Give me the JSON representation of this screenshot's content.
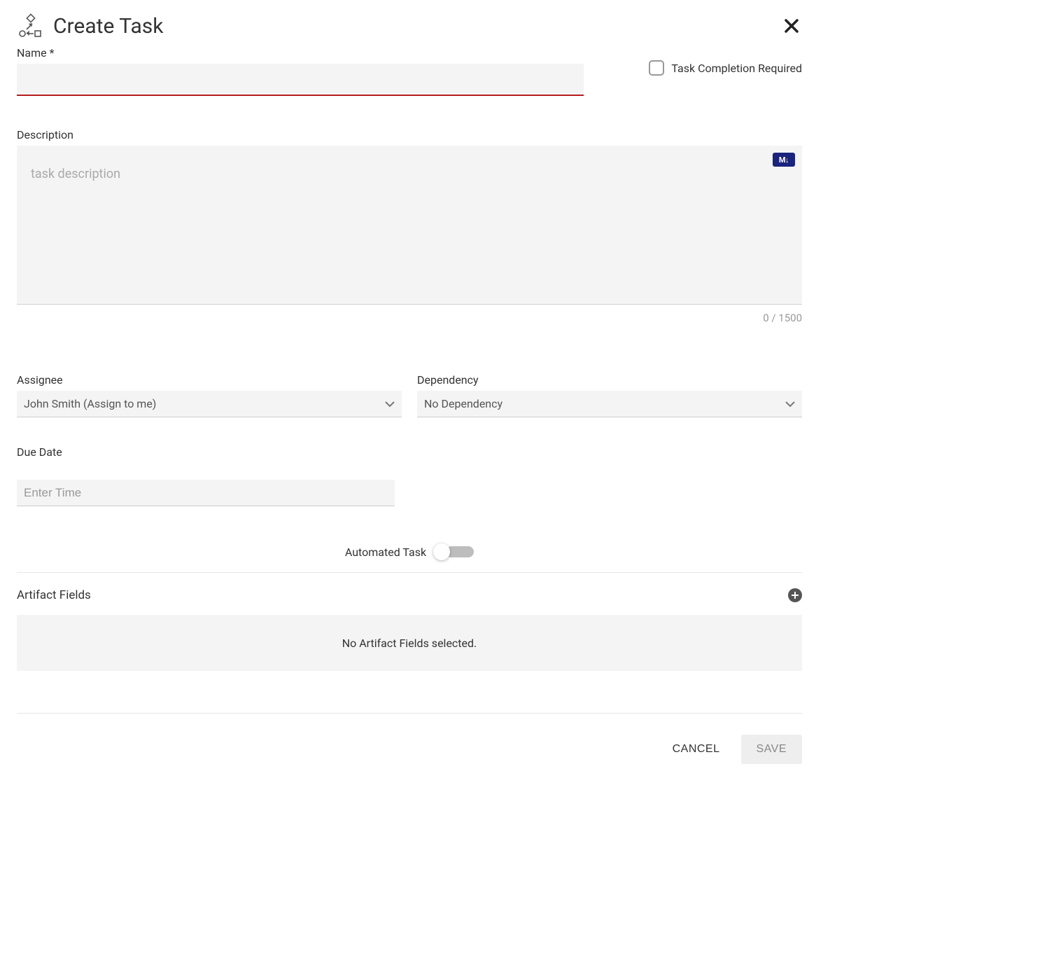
{
  "header": {
    "title": "Create Task"
  },
  "name_field": {
    "label": "Name *",
    "value": ""
  },
  "completion_required": {
    "label": "Task Completion Required",
    "checked": false
  },
  "description": {
    "label": "Description",
    "placeholder": "task description",
    "value": "",
    "char_count": "0 / 1500",
    "markdown_badge": "M↓"
  },
  "assignee": {
    "label": "Assignee",
    "value": "John Smith (Assign to me)"
  },
  "dependency": {
    "label": "Dependency",
    "value": "No Dependency"
  },
  "due_date": {
    "label": "Due Date",
    "placeholder": "Enter Time",
    "value": ""
  },
  "automated_task": {
    "label": "Automated Task",
    "on": false
  },
  "artifact": {
    "label": "Artifact Fields",
    "empty_text": "No Artifact Fields selected."
  },
  "footer": {
    "cancel": "CANCEL",
    "save": "SAVE"
  }
}
